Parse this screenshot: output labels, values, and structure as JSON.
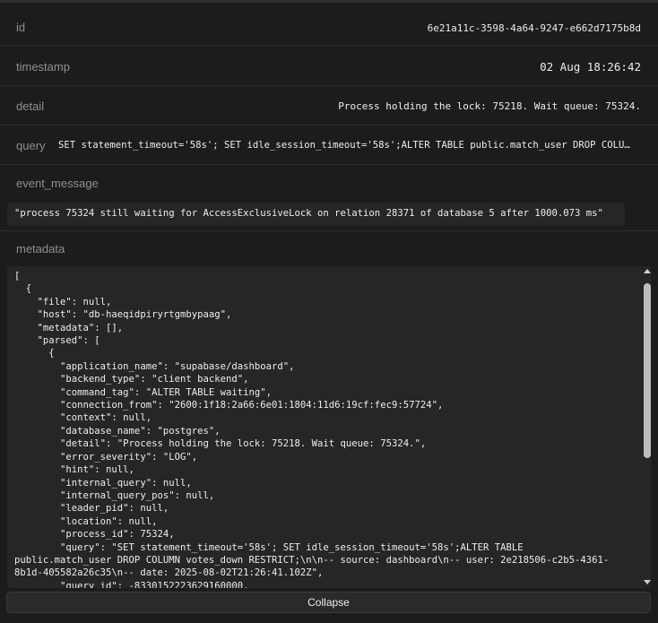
{
  "fields": {
    "id": {
      "label": "id",
      "value": "6e21a11c-3598-4a64-9247-e662d7175b8d"
    },
    "timestamp": {
      "label": "timestamp",
      "value": "02 Aug 18:26:42"
    },
    "detail": {
      "label": "detail",
      "value": "Process holding the lock: 75218. Wait queue: 75324."
    },
    "query": {
      "label": "query",
      "value": "SET statement_timeout='58s'; SET idle_session_timeout='58s';ALTER TABLE public.match_user DROP COLU…"
    },
    "event_message": {
      "label": "event_message",
      "value": "\"process 75324 still waiting for AccessExclusiveLock on relation 28371 of database 5 after 1000.073 ms\""
    },
    "metadata": {
      "label": "metadata"
    }
  },
  "metadata_lines": [
    "[",
    "  {",
    "    \"file\": null,",
    "    \"host\": \"db-haeqidpiryrtgmbypaag\",",
    "    \"metadata\": [],",
    "    \"parsed\": [",
    "      {",
    "        \"application_name\": \"supabase/dashboard\",",
    "        \"backend_type\": \"client backend\",",
    "        \"command_tag\": \"ALTER TABLE waiting\",",
    "        \"connection_from\": \"2600:1f18:2a66:6e01:1804:11d6:19cf:fec9:57724\",",
    "        \"context\": null,",
    "        \"database_name\": \"postgres\",",
    "        \"detail\": \"Process holding the lock: 75218. Wait queue: 75324.\",",
    "        \"error_severity\": \"LOG\",",
    "        \"hint\": null,",
    "        \"internal_query\": null,",
    "        \"internal_query_pos\": null,",
    "        \"leader_pid\": null,",
    "        \"location\": null,",
    "        \"process_id\": 75324,",
    "        \"query\": \"SET statement_timeout='58s'; SET idle_session_timeout='58s';ALTER TABLE",
    "public.match_user DROP COLUMN votes_down RESTRICT;\\n\\n-- source: dashboard\\n-- user: 2e218506-c2b5-4361-",
    "8b1d-405582a26c35\\n-- date: 2025-08-02T21:26:41.102Z\",",
    "        \"query_id\": -8330152223629160000,"
  ],
  "collapse_label": "Collapse"
}
